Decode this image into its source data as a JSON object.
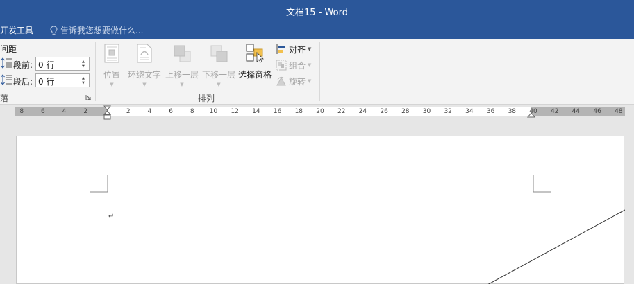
{
  "window": {
    "title": "文档15 - Word"
  },
  "tabs": {
    "developer": "开发工具",
    "tell_me": "告诉我您想要做什么..."
  },
  "ribbon": {
    "spacing_group_label": "间距",
    "before_label": "段前:",
    "before_value": "0 行",
    "after_label": "段后:",
    "after_value": "0 行",
    "paragraph_group_tail": "落",
    "arrange_group_label": "排列",
    "buttons": {
      "position": "位置",
      "wrap_text": "环绕文字",
      "bring_forward": "上移一层",
      "send_backward": "下移一层",
      "selection_pane": "选择窗格",
      "align": "对齐",
      "group": "组合",
      "rotate": "旋转"
    }
  },
  "ruler": {
    "left_labels": [
      "8",
      "6",
      "4",
      "2"
    ],
    "main_labels": [
      "2",
      "4",
      "6",
      "8",
      "10",
      "12",
      "14",
      "16",
      "18",
      "20",
      "22",
      "24",
      "26",
      "28",
      "30",
      "32",
      "34",
      "36",
      "38",
      "40"
    ],
    "right_labels": [
      "42",
      "44",
      "46",
      "48"
    ]
  },
  "colors": {
    "accent": "#2b579a",
    "ribbon_bg": "#f3f3f3",
    "workspace": "#e6e6e6"
  },
  "icons": [
    "lightbulb-icon",
    "spacing-before-icon",
    "spacing-after-icon",
    "position-icon",
    "wrap-text-icon",
    "bring-forward-icon",
    "send-backward-icon",
    "selection-pane-icon",
    "align-icon",
    "group-icon",
    "rotate-icon",
    "dialog-launcher-icon",
    "paragraph-mark-icon"
  ]
}
